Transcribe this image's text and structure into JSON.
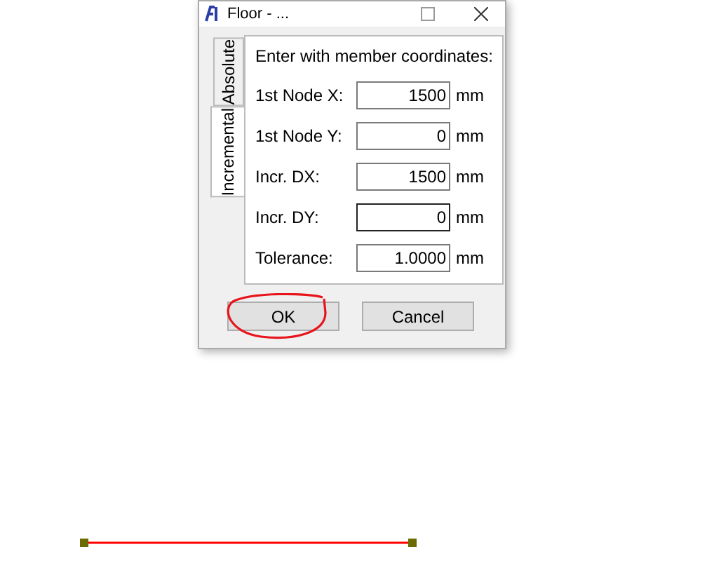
{
  "window": {
    "title": "Floor - ..."
  },
  "tabs": [
    {
      "label": "Absolute",
      "selected": false
    },
    {
      "label": "Incremental",
      "selected": true
    }
  ],
  "panel": {
    "heading": "Enter with member coordinates:",
    "fields": [
      {
        "label": "1st Node X:",
        "value": "1500",
        "unit": "mm",
        "focused": false
      },
      {
        "label": "1st Node Y:",
        "value": "0",
        "unit": "mm",
        "focused": false
      },
      {
        "label": "Incr. DX:",
        "value": "1500",
        "unit": "mm",
        "focused": false
      },
      {
        "label": "Incr. DY:",
        "value": "0",
        "unit": "mm",
        "focused": true
      },
      {
        "label": "Tolerance:",
        "value": "1.0000",
        "unit": "mm",
        "focused": false
      }
    ]
  },
  "buttons": [
    "OK",
    "Cancel"
  ]
}
